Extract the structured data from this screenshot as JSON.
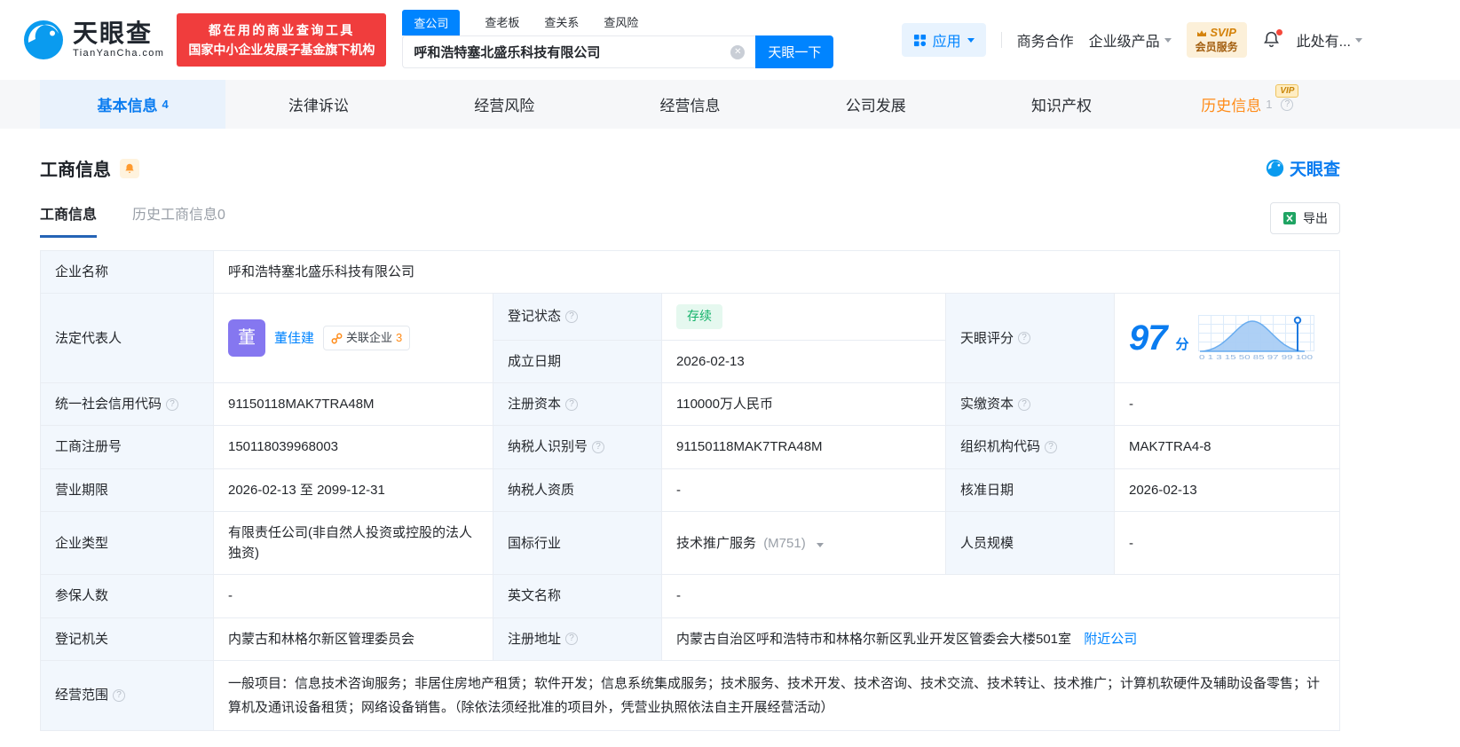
{
  "brand": {
    "name": "天眼查",
    "domain": "TianYanCha.com"
  },
  "icons": {
    "help_glyph": "?",
    "clear_glyph": "✕"
  },
  "colors": {
    "brand_blue": "#0084ff",
    "banner_red": "#f03d3d",
    "orange": "#ff8b17",
    "status_green": "#12b269"
  },
  "header": {
    "promo_line1": "都在用的商业查询工具",
    "promo_line2": "国家中小企业发展子基金旗下机构",
    "search_tabs": [
      {
        "label": "查公司"
      },
      {
        "label": "查老板"
      },
      {
        "label": "查关系"
      },
      {
        "label": "查风险"
      }
    ],
    "search_value": "呼和浩特塞北盛乐科技有限公司",
    "search_button": "天眼一下",
    "apps_label": "应用",
    "coop_label": "商务合作",
    "enterprise_label": "企业级产品",
    "vip_top": "SVIP",
    "vip_bottom": "会员服务",
    "user_label": "此处有..."
  },
  "nav_tabs": [
    {
      "label": "基本信息",
      "count": "4"
    },
    {
      "label": "法律诉讼"
    },
    {
      "label": "经营风险"
    },
    {
      "label": "经营信息"
    },
    {
      "label": "公司发展"
    },
    {
      "label": "知识产权"
    },
    {
      "label": "历史信息",
      "count": "1",
      "badge": "VIP"
    }
  ],
  "section": {
    "title": "工商信息",
    "brand_logo": "天眼查",
    "subtabs": [
      {
        "label": "工商信息"
      },
      {
        "label": "历史工商信息0"
      }
    ],
    "export_label": "导出"
  },
  "table": {
    "company_name": {
      "label": "企业名称",
      "value": "呼和浩特塞北盛乐科技有限公司"
    },
    "legal_rep": {
      "label": "法定代表人",
      "avatar_char": "董",
      "name": "董佳建",
      "related_label": "关联企业",
      "related_count": "3"
    },
    "reg_status": {
      "label": "登记状态",
      "value": "存续"
    },
    "establish_date": {
      "label": "成立日期",
      "value": "2026-02-13"
    },
    "score": {
      "label": "天眼评分",
      "value": "97",
      "unit": "分",
      "axis_labels": "0 1 3 15 50 85 97 99 100"
    },
    "credit_code": {
      "label": "统一社会信用代码",
      "value": "91150118MAK7TRA48M"
    },
    "reg_capital": {
      "label": "注册资本",
      "value": "110000万人民币"
    },
    "paid_capital": {
      "label": "实缴资本",
      "value": "-"
    },
    "reg_number": {
      "label": "工商注册号",
      "value": "150118039968003"
    },
    "taxpayer_id": {
      "label": "纳税人识别号",
      "value": "91150118MAK7TRA48M"
    },
    "org_code": {
      "label": "组织机构代码",
      "value": "MAK7TRA4-8"
    },
    "business_term": {
      "label": "营业期限",
      "value": "2026-02-13 至 2099-12-31"
    },
    "taxpayer_quality": {
      "label": "纳税人资质",
      "value": "-"
    },
    "approval_date": {
      "label": "核准日期",
      "value": "2026-02-13"
    },
    "company_type": {
      "label": "企业类型",
      "value": "有限责任公司(非自然人投资或控股的法人独资)"
    },
    "industry": {
      "label": "国标行业",
      "value": "技术推广服务",
      "code": "(M751)"
    },
    "staff_size": {
      "label": "人员规模",
      "value": "-"
    },
    "insured_count": {
      "label": "参保人数",
      "value": "-"
    },
    "english_name": {
      "label": "英文名称",
      "value": "-"
    },
    "reg_authority": {
      "label": "登记机关",
      "value": "内蒙古和林格尔新区管理委员会"
    },
    "reg_address": {
      "label": "注册地址",
      "value": "内蒙古自治区呼和浩特市和林格尔新区乳业开发区管委会大楼501室",
      "link": "附近公司"
    },
    "business_scope": {
      "label": "经营范围",
      "value": "一般项目：信息技术咨询服务；非居住房地产租赁；软件开发；信息系统集成服务；技术服务、技术开发、技术咨询、技术交流、技术转让、技术推广；计算机软硬件及辅助设备零售；计算机及通讯设备租赁；网络设备销售。（除依法须经批准的项目外，凭营业执照依法自主开展经营活动）"
    }
  }
}
